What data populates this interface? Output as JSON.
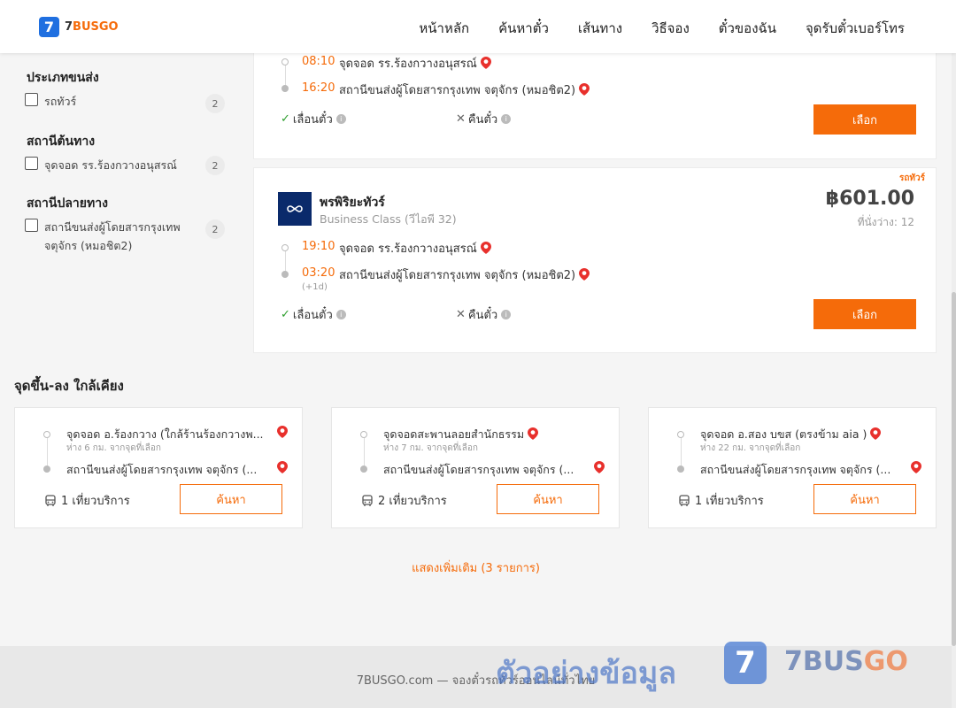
{
  "brand": {
    "logo_digit": "7",
    "logo_prefix": "7",
    "logo_suffix": "BUSGO",
    "accent_color": "#f56b0a"
  },
  "nav": [
    "หน้าหลัก",
    "ค้นหาตั๋ว",
    "เส้นทาง",
    "วิธีจอง",
    "ตั๋วของฉัน",
    "จุดรับตั๋วเบอร์โทร"
  ],
  "filters": [
    {
      "title": "ประเภทขนส่ง",
      "options": [
        {
          "label": "รถทัวร์",
          "count": "2"
        }
      ]
    },
    {
      "title": "สถานีต้นทาง",
      "options": [
        {
          "label": "จุดจอด รร.ร้องกวางอนุสรณ์",
          "count": "2"
        }
      ]
    },
    {
      "title": "สถานีปลายทาง",
      "options": [
        {
          "label": "สถานีขนส่งผู้โดยสารกรุงเทพ จตุจักร (หมอชิต2)",
          "count": "2"
        }
      ]
    }
  ],
  "trip1": {
    "dep_time": "08:10",
    "dep_stop": "จุดจอด รร.ร้องกวางอนุสรณ์",
    "arr_time": "16:20",
    "arr_stop": "สถานีขนส่งผู้โดยสารกรุงเทพ จตุจักร (หมอชิต2)",
    "opt_change": "เลื่อนตั๋ว",
    "opt_refund": "คืนตั๋ว",
    "select_label": "เลือก"
  },
  "trip2": {
    "type_tag": "รถทัวร์",
    "operator": "พรพิริยะทัวร์",
    "class": "Business Class (วีไอพี 32)",
    "price": "฿601.00",
    "seats": "ที่นั่งว่าง: 12",
    "dep_time": "19:10",
    "dep_stop": "จุดจอด รร.ร้องกวางอนุสรณ์",
    "arr_time": "03:20",
    "arr_next_day": "(+1d)",
    "arr_stop": "สถานีขนส่งผู้โดยสารกรุงเทพ จตุจักร (หมอชิต2)",
    "opt_change": "เลื่อนตั๋ว",
    "opt_refund": "คืนตั๋ว",
    "select_label": "เลือก"
  },
  "nearby": {
    "title": "จุดขึ้น-ลง ใกล้เคียง",
    "cards": [
      {
        "from": "จุดจอด อ.ร้องกวาง (ใกล้ร้านร้องกวางพ...",
        "distance": "ห่าง 6 กม. จากจุดที่เลือก",
        "to": "สถานีขนส่งผู้โดยสารกรุงเทพ จตุจักร (...",
        "services": "1 เที่ยวบริการ",
        "button": "ค้นหา"
      },
      {
        "from": "จุดจอดสะพานลอยสำนักธรรม",
        "distance": "ห่าง 7 กม. จากจุดที่เลือก",
        "to": "สถานีขนส่งผู้โดยสารกรุงเทพ จตุจักร (...",
        "services": "2 เที่ยวบริการ",
        "button": "ค้นหา"
      },
      {
        "from": "จุดจอด อ.สอง บขส (ตรงข้าม aia )",
        "distance": "ห่าง 22 กม. จากจุดที่เลือก",
        "to": "สถานีขนส่งผู้โดยสารกรุงเทพ จตุจักร (...",
        "services": "1 เที่ยวบริการ",
        "button": "ค้นหา"
      }
    ]
  },
  "show_more": "แสดงเพิ่มเติม (3 รายการ)",
  "footer": "7BUSGO.com — จองตั๋วรถทัวร์ออนไลน์ทั่วไทย",
  "watermark": {
    "text": "ตัวอย่างข้อมูล",
    "digit": "7",
    "name_prefix": "7BUS",
    "name_suffix": "GO"
  }
}
